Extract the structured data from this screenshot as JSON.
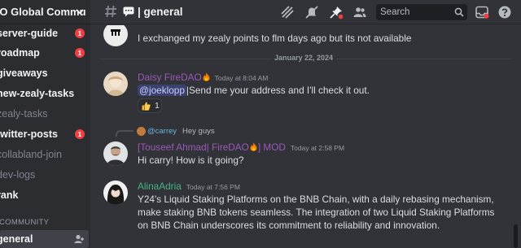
{
  "server": {
    "name": "AO Global Commu"
  },
  "sidebar": {
    "channels": [
      {
        "label": "server-guide",
        "badge": "1",
        "muted": false
      },
      {
        "label": "roadmap",
        "badge": "1",
        "muted": false
      },
      {
        "label": "giveaways",
        "badge": "",
        "muted": false
      },
      {
        "label": "new-zealy-tasks",
        "badge": "",
        "muted": false
      },
      {
        "label": "zealy-tasks",
        "badge": "",
        "muted": true
      },
      {
        "label": "twitter-posts",
        "badge": "1",
        "muted": false
      },
      {
        "label": "collabland-join",
        "badge": "",
        "muted": true
      },
      {
        "label": "dev-logs",
        "badge": "",
        "muted": true
      },
      {
        "label": "rank",
        "badge": "",
        "muted": false
      }
    ],
    "category": "COMMUNITY",
    "active_channel": "general"
  },
  "header": {
    "title": "| general",
    "search_placeholder": "Search"
  },
  "messages": {
    "first_text": "I exchanged my zealy points to flm days ago but its not available",
    "date_divider": "January 22, 2024",
    "m1": {
      "author": "Daisy  FireDAO",
      "author_color": "#9b59b6",
      "time": "Today at 8:04 AM",
      "mention": "@joeklopp",
      "text": "|Send me your address and I'll check it out.",
      "reaction_count": "1"
    },
    "reply": {
      "author": "@carrey",
      "text": "Hey guys"
    },
    "m2": {
      "author": "[Touseef Ahmad| FireDAO",
      "author_suffix": "] MOD",
      "author_color": "#9b59b6",
      "time": "Today at 2:58 PM",
      "text": "Hi carry! How is it going?"
    },
    "m3": {
      "author": "AlinaAdria",
      "author_color": "#43b581",
      "time": "Today at 7:56 PM",
      "lines": [
        "Y24's Liquid Staking Platforms on the BNB Chain, with a daily rebasing mechanism,",
        "make staking BNB tokens seamless. The integration of two Liquid Staking Platforms",
        "on BNB Chain underscores its commitment to reliability and innovation."
      ]
    }
  },
  "colors": {
    "accent": "#5865f2",
    "badge": "#f23f43",
    "fire": "#f57c00"
  },
  "icons": [
    "hash-icon",
    "threads-icon",
    "mute-icon",
    "pin-icon",
    "members-icon",
    "search-icon",
    "inbox-icon",
    "help-icon",
    "thumbs-up-icon",
    "fire-icon",
    "add-member-icon"
  ]
}
